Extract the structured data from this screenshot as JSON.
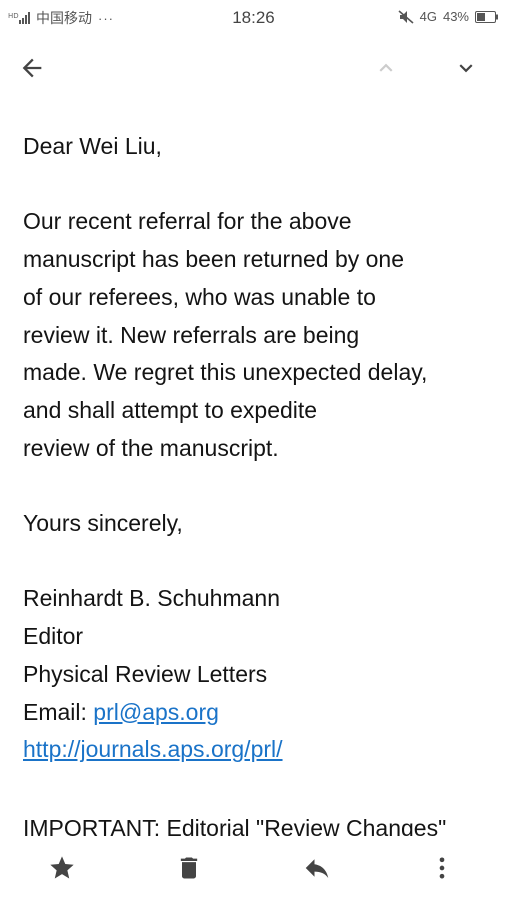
{
  "status_bar": {
    "carrier": "中国移动",
    "more": "···",
    "time": "18:26",
    "network": "4G",
    "battery": "43%"
  },
  "toolbar": {
    "icons": [
      "back-arrow-icon",
      "chevron-up-icon",
      "chevron-down-icon"
    ]
  },
  "message": {
    "lines": [
      "Dear Wei Liu,",
      "",
      "Our recent referral for the above",
      "manuscript has been returned by one",
      "of our referees, who was unable to",
      "review it.  New referrals are being",
      "made.  We regret this unexpected delay,",
      "and shall attempt to expedite",
      "review of the manuscript.",
      "",
      "Yours sincerely,",
      "",
      "Reinhardt B. Schuhmann",
      "Editor",
      "Physical Review Letters"
    ],
    "email_label": "Email: ",
    "email_link": "prl@aps.org",
    "url_link": "http://journals.aps.org/prl/",
    "cut_off_line": "IMPORTANT: Editorial \"Review Changes\""
  },
  "action_bar": {
    "icons": [
      "star-icon",
      "trash-icon",
      "reply-icon",
      "more-vert-icon"
    ]
  },
  "colors": {
    "link": "#1a73c8",
    "icon_dark": "#444444",
    "icon_light": "#cccccc"
  }
}
